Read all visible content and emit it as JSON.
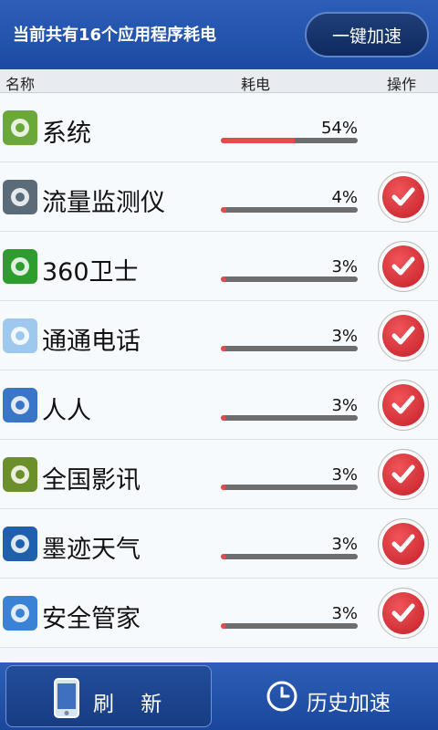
{
  "header": {
    "title": "当前共有16个应用程序耗电",
    "boost_button": "一键加速"
  },
  "columns": {
    "name": "名称",
    "power": "耗电",
    "action": "操作"
  },
  "apps": [
    {
      "name": "系统",
      "percent_label": "54%",
      "percent": 54,
      "icon": "android-icon",
      "icon_color": "#6aa83a",
      "has_action": false
    },
    {
      "name": "流量监测仪",
      "percent_label": "4%",
      "percent": 4,
      "icon": "speedometer-icon",
      "icon_color": "#5b6b78",
      "has_action": true
    },
    {
      "name": "360卫士",
      "percent_label": "3%",
      "percent": 3,
      "icon": "360-shield-icon",
      "icon_color": "#2f9c2f",
      "has_action": true
    },
    {
      "name": "通通电话",
      "percent_label": "3%",
      "percent": 3,
      "icon": "cloud-phone-icon",
      "icon_color": "#9ec8ee",
      "has_action": true
    },
    {
      "name": "人人",
      "percent_label": "3%",
      "percent": 3,
      "icon": "renren-icon",
      "icon_color": "#3a76c8",
      "has_action": true
    },
    {
      "name": "全国影讯",
      "percent_label": "3%",
      "percent": 3,
      "icon": "mtime-icon",
      "icon_color": "#6b8f2a",
      "has_action": true
    },
    {
      "name": "墨迹天气",
      "percent_label": "3%",
      "percent": 3,
      "icon": "moji-weather-icon",
      "icon_color": "#1f5fae",
      "has_action": true
    },
    {
      "name": "安全管家",
      "percent_label": "3%",
      "percent": 3,
      "icon": "security-shield-icon",
      "icon_color": "#3a82d6",
      "has_action": true
    }
  ],
  "footer": {
    "refresh_label": "刷    新",
    "history_label": "历史加速"
  }
}
